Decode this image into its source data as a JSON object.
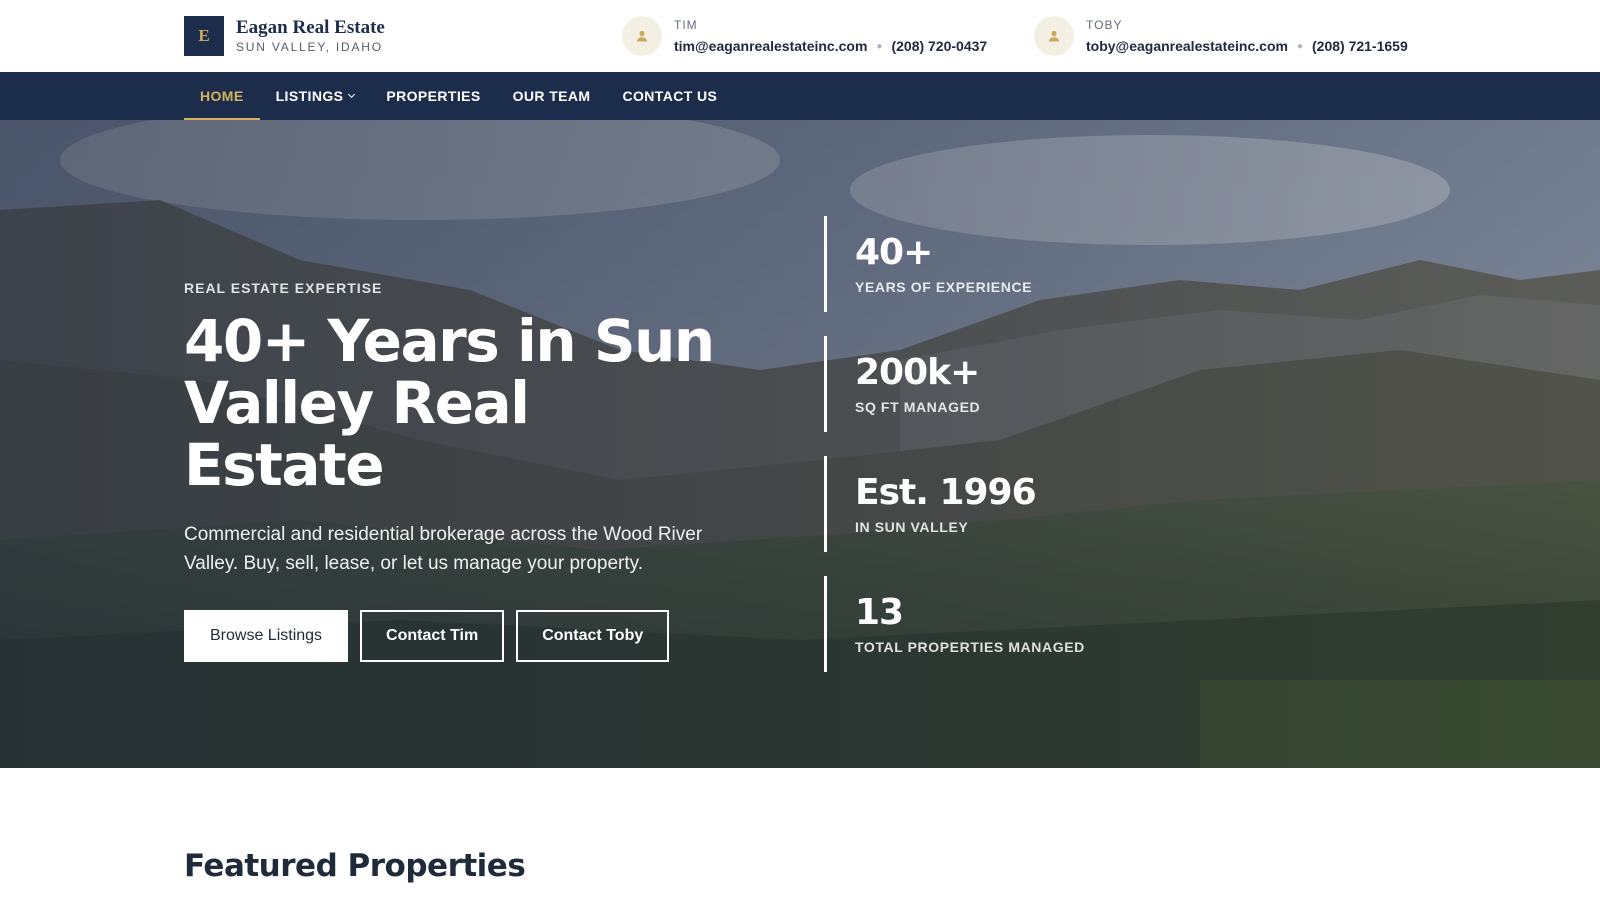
{
  "brand": {
    "mark": "E",
    "name": "Eagan Real Estate",
    "location": "SUN VALLEY, IDAHO"
  },
  "contacts": [
    {
      "name": "TIM",
      "email": "tim@eaganrealestateinc.com",
      "phone": "(208) 720-0437",
      "icon": "person-icon"
    },
    {
      "name": "TOBY",
      "email": "toby@eaganrealestateinc.com",
      "phone": "(208) 721-1659",
      "icon": "person-icon"
    }
  ],
  "nav": {
    "items": [
      {
        "label": "HOME",
        "active": true
      },
      {
        "label": "LISTINGS",
        "dropdown": true
      },
      {
        "label": "PROPERTIES"
      },
      {
        "label": "OUR TEAM"
      },
      {
        "label": "CONTACT US"
      }
    ]
  },
  "hero": {
    "eyebrow": "REAL ESTATE EXPERTISE",
    "headline": "40+ Years in Sun Valley Real Estate",
    "description": "Commercial and residential brokerage across the Wood River Valley. Buy, sell, lease, or let us manage your property.",
    "buttons": {
      "browse": "Browse Listings",
      "contact_tim": "Contact Tim",
      "contact_toby": "Contact Toby"
    },
    "stats": [
      {
        "value": "40+",
        "label": "YEARS OF EXPERIENCE"
      },
      {
        "value": "200k+",
        "label": "SQ FT MANAGED"
      },
      {
        "value": "Est. 1996",
        "label": "IN SUN VALLEY"
      },
      {
        "value": "13",
        "label": "TOTAL PROPERTIES MANAGED"
      }
    ]
  },
  "featured": {
    "title": "Featured Properties"
  },
  "colors": {
    "navy": "#1c2d4c",
    "gold": "#d7b25e",
    "text": "#1f2a3a"
  }
}
